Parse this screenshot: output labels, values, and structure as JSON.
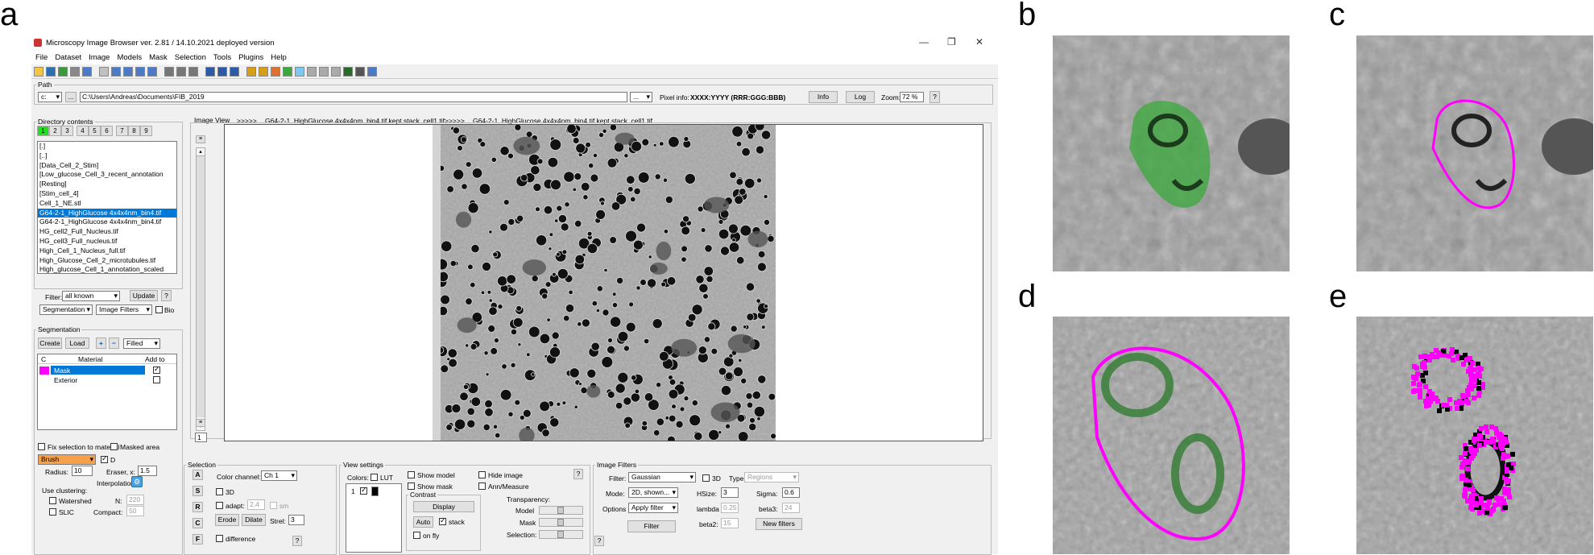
{
  "panel_letters": {
    "a": "a",
    "b": "b",
    "c": "c",
    "d": "d",
    "e": "e"
  },
  "window": {
    "title": "Microscopy Image Browser ver. 2.81 / 14.10.2021 deployed version",
    "controls": [
      "—",
      "❐",
      "✕"
    ]
  },
  "menu": [
    "File",
    "Dataset",
    "Image",
    "Models",
    "Mask",
    "Selection",
    "Tools",
    "Plugins",
    "Help"
  ],
  "path": {
    "title": "Path",
    "drive": "c:",
    "dots": "...",
    "value": "C:\\Users\\Andreas\\Documents\\FIB_2019",
    "dropdown": "...",
    "pixel_info_label": "Pixel info:",
    "pixel_info_value": "XXXX:YYYY (RRR:GGG:BBB)",
    "info_btn": "Info",
    "log_btn": "Log",
    "zoom_label": "Zoom:",
    "zoom_value": "72 %",
    "help": "?"
  },
  "directory": {
    "title": "Directory contents",
    "tabs": [
      "1",
      "2",
      "3",
      "4",
      "5",
      "6",
      "7",
      "8",
      "9"
    ],
    "active_color": "#22dd22",
    "files": [
      "[.]",
      "[..]",
      "[Data_Cell_2_Stim]",
      "[Low_glucose_Cell_3_recent_annotation",
      "[Resting]",
      "[Stim_cell_4]",
      "Cell_1_NE.stl",
      "G64-2-1_HighGlucose 4x4x4nm_bin4.tif",
      "G64-2-1_HighGlucose 4x4x4nm_bin4.tif",
      "HG_cell2_Full_Nucleus.tif",
      "HG_cell3_Full_nucleus.tif",
      "High_Cell_1_Nucleus_full.tif",
      "High_Glucose_Cell_2_microtubules.tif",
      "High_glucose_Cell_1_annotation_scaled"
    ],
    "selected_index": 7,
    "filter_label": "Filter:",
    "filter_value": "all known",
    "update_btn": "Update",
    "help": "?",
    "seg_dropdown": "Segmentation",
    "filters_dropdown": "Image Filters",
    "bio_label": "Bio"
  },
  "segmentation": {
    "title": "Segmentation",
    "create_btn": "Create",
    "load_btn": "Load",
    "plus": "+",
    "minus": "−",
    "mode": "Filled",
    "col_c": "C",
    "col_material": "Material",
    "col_addto": "Add to",
    "rows": [
      {
        "name": "Mask",
        "color": "#ff00ff",
        "checked": true,
        "selected": true
      },
      {
        "name": "Exterior",
        "color": "",
        "checked": false,
        "selected": false
      }
    ],
    "fix_label": "Fix selection to material",
    "masked_label": "Masked area",
    "tool_value": "Brush",
    "tool_color": "#f7a04a",
    "d_label": "D",
    "radius_label": "Radius:",
    "radius_value": "10",
    "eraser_label": "Eraser, x:",
    "eraser_value": "1.5",
    "interp_label": "Interpolation:",
    "clustering_label": "Use clustering:",
    "watershed_label": "Watershed",
    "slic_label": "SLIC",
    "n_label": "N:",
    "n_value": "220",
    "compact_label": "Compact:",
    "compact_value": "50"
  },
  "image_view": {
    "title": "Image View",
    "arrows1": ">>>>>",
    "file1": "G64-2-1_HighGlucose 4x4x4nm_bin4.tif kept stack_cell1.tif",
    "arrows2": ">>>>>",
    "file2": "G64-2-1_HighGlucose 4x4x4nm_bin4.tif kept stack_cell1.tif",
    "slice": "1"
  },
  "selection": {
    "title": "Selection",
    "a": "A",
    "s": "S",
    "r": "R",
    "c": "C",
    "f": "F",
    "channel_label": "Color channel:",
    "channel_value": "Ch 1",
    "3d_label": "3D",
    "adapt_label": "adapt:",
    "adapt_value": "2.4",
    "sm_label": "sm",
    "erode_btn": "Erode",
    "dilate_btn": "Dilate",
    "strel_label": "Strel:",
    "strel_value": "3",
    "diff_label": "difference",
    "help": "?"
  },
  "view_settings": {
    "title": "View settings",
    "colors_label": "Colors:",
    "lut_label": "LUT",
    "channel_row": "1",
    "show_model": "Show model",
    "show_mask": "Show mask",
    "hide_image": "Hide image",
    "ann_measure": "Ann/Measure",
    "contrast_title": "Contrast",
    "display_btn": "Display",
    "auto_btn": "Auto",
    "stack_label": "stack",
    "onfly_label": "on fly",
    "transparency_label": "Transparency:",
    "model_label": "Model",
    "mask_label": "Mask",
    "selection_label": "Selection:",
    "help": "?"
  },
  "image_filters": {
    "title": "Image Filters",
    "filter_label": "Filter:",
    "filter_value": "Gaussian",
    "3d_label": "3D",
    "type_label": "Type:",
    "type_value": "Regions",
    "mode_label": "Mode:",
    "mode_value": "2D, shown...",
    "options_label": "Options",
    "options_value": "Apply filter",
    "hsize_label": "HSize:",
    "hsize_value": "3",
    "sigma_label": "Sigma:",
    "sigma_value": "0.6",
    "lambda_label": "lambda",
    "lambda_value": "0.25",
    "beta3_label": "beta3:",
    "beta3_value": "24",
    "beta2_label": "beta2:",
    "beta2_value": "15",
    "filter_btn": "Filter",
    "new_filters_btn": "New filters",
    "help": "?"
  },
  "colors": {
    "highlight": "#0078d7",
    "overlay_green": "#3aa83a",
    "overlay_magenta": "#ff00ff"
  }
}
